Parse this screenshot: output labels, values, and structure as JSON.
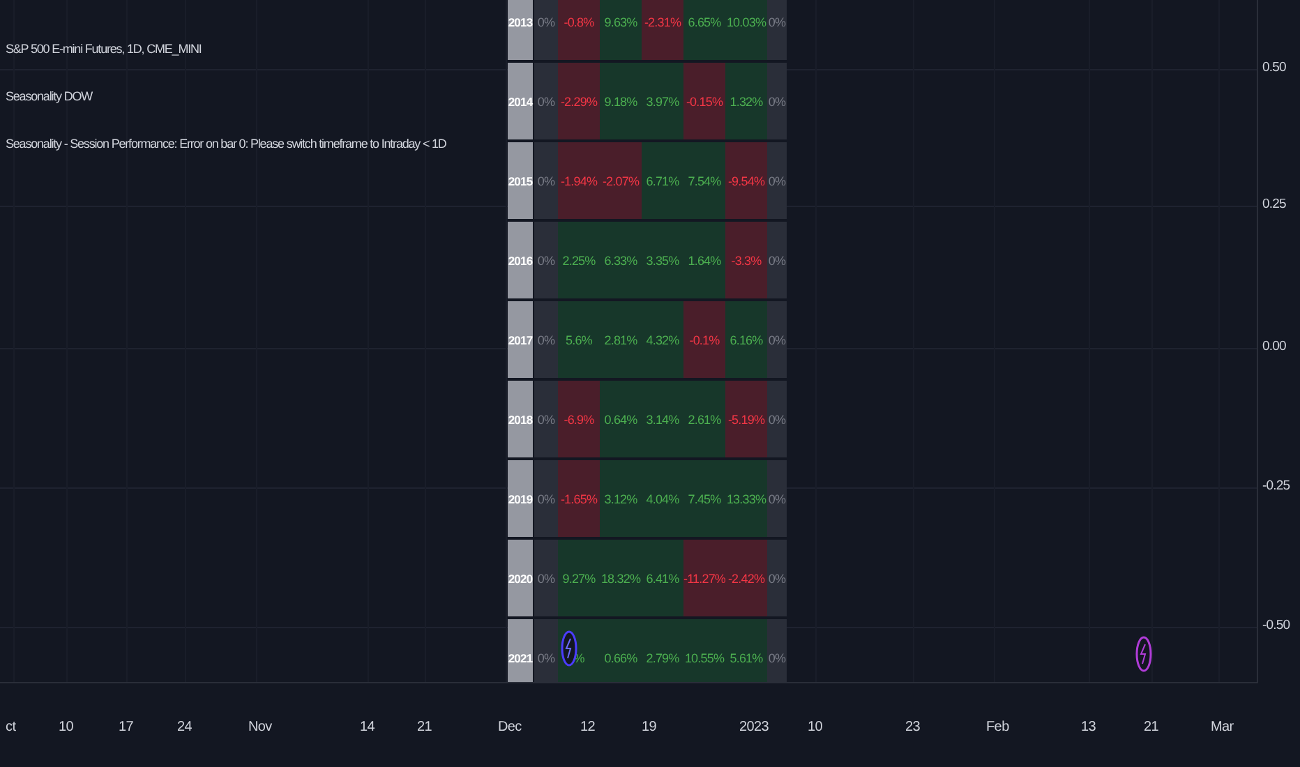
{
  "legend": [
    "S&P 500 E-mini Futures, 1D, CME_MINI",
    "Seasonality DOW",
    "Seasonality - Session Performance: Error on bar 0: Please switch timeframe to Intraday < 1D"
  ],
  "seasonality_table": {
    "rows": [
      {
        "year": "2013",
        "cells": [
          {
            "text": "0%",
            "kind": "flat"
          },
          {
            "text": "-0.8%",
            "kind": "down"
          },
          {
            "text": "9.63%",
            "kind": "up"
          },
          {
            "text": "-2.31%",
            "kind": "down"
          },
          {
            "text": "6.65%",
            "kind": "up"
          },
          {
            "text": "10.03%",
            "kind": "up"
          },
          {
            "text": "0%",
            "kind": "flat"
          }
        ]
      },
      {
        "year": "2014",
        "cells": [
          {
            "text": "0%",
            "kind": "flat"
          },
          {
            "text": "-2.29%",
            "kind": "down"
          },
          {
            "text": "9.18%",
            "kind": "up"
          },
          {
            "text": "3.97%",
            "kind": "up"
          },
          {
            "text": "-0.15%",
            "kind": "down"
          },
          {
            "text": "1.32%",
            "kind": "up"
          },
          {
            "text": "0%",
            "kind": "flat"
          }
        ]
      },
      {
        "year": "2015",
        "cells": [
          {
            "text": "0%",
            "kind": "flat"
          },
          {
            "text": "-1.94%",
            "kind": "down"
          },
          {
            "text": "-2.07%",
            "kind": "down"
          },
          {
            "text": "6.71%",
            "kind": "up"
          },
          {
            "text": "7.54%",
            "kind": "up"
          },
          {
            "text": "-9.54%",
            "kind": "down"
          },
          {
            "text": "0%",
            "kind": "flat"
          }
        ]
      },
      {
        "year": "2016",
        "cells": [
          {
            "text": "0%",
            "kind": "flat"
          },
          {
            "text": "2.25%",
            "kind": "up"
          },
          {
            "text": "6.33%",
            "kind": "up"
          },
          {
            "text": "3.35%",
            "kind": "up"
          },
          {
            "text": "1.64%",
            "kind": "up"
          },
          {
            "text": "-3.3%",
            "kind": "down"
          },
          {
            "text": "0%",
            "kind": "flat"
          }
        ]
      },
      {
        "year": "2017",
        "cells": [
          {
            "text": "0%",
            "kind": "flat"
          },
          {
            "text": "5.6%",
            "kind": "up"
          },
          {
            "text": "2.81%",
            "kind": "up"
          },
          {
            "text": "4.32%",
            "kind": "up"
          },
          {
            "text": "-0.1%",
            "kind": "down"
          },
          {
            "text": "6.16%",
            "kind": "up"
          },
          {
            "text": "0%",
            "kind": "flat"
          }
        ]
      },
      {
        "year": "2018",
        "cells": [
          {
            "text": "0%",
            "kind": "flat"
          },
          {
            "text": "-6.9%",
            "kind": "down"
          },
          {
            "text": "0.64%",
            "kind": "up"
          },
          {
            "text": "3.14%",
            "kind": "up"
          },
          {
            "text": "2.61%",
            "kind": "up"
          },
          {
            "text": "-5.19%",
            "kind": "down"
          },
          {
            "text": "0%",
            "kind": "flat"
          }
        ]
      },
      {
        "year": "2019",
        "cells": [
          {
            "text": "0%",
            "kind": "flat"
          },
          {
            "text": "-1.65%",
            "kind": "down"
          },
          {
            "text": "3.12%",
            "kind": "up"
          },
          {
            "text": "4.04%",
            "kind": "up"
          },
          {
            "text": "7.45%",
            "kind": "up"
          },
          {
            "text": "13.33%",
            "kind": "up"
          },
          {
            "text": "0%",
            "kind": "flat"
          }
        ]
      },
      {
        "year": "2020",
        "cells": [
          {
            "text": "0%",
            "kind": "flat"
          },
          {
            "text": "9.27%",
            "kind": "up"
          },
          {
            "text": "18.32%",
            "kind": "up"
          },
          {
            "text": "6.41%",
            "kind": "up"
          },
          {
            "text": "-11.27%",
            "kind": "down"
          },
          {
            "text": "-2.42%",
            "kind": "down"
          },
          {
            "text": "0%",
            "kind": "flat"
          }
        ]
      },
      {
        "year": "2021",
        "cells": [
          {
            "text": "0%",
            "kind": "flat"
          },
          {
            "text": "%",
            "kind": "up"
          },
          {
            "text": "0.66%",
            "kind": "up"
          },
          {
            "text": "2.79%",
            "kind": "up"
          },
          {
            "text": "10.55%",
            "kind": "up"
          },
          {
            "text": "5.61%",
            "kind": "up"
          },
          {
            "text": "0%",
            "kind": "flat"
          }
        ]
      }
    ]
  },
  "price_axis": {
    "labels": [
      "0.50",
      "0.25",
      "0.00",
      "-0.25",
      "-0.50"
    ]
  },
  "time_axis": {
    "labels": [
      "ct",
      "10",
      "17",
      "24",
      "Nov",
      "14",
      "21",
      "Dec",
      "12",
      "19",
      "2023",
      "10",
      "23",
      "Feb",
      "13",
      "21",
      "Mar"
    ]
  }
}
